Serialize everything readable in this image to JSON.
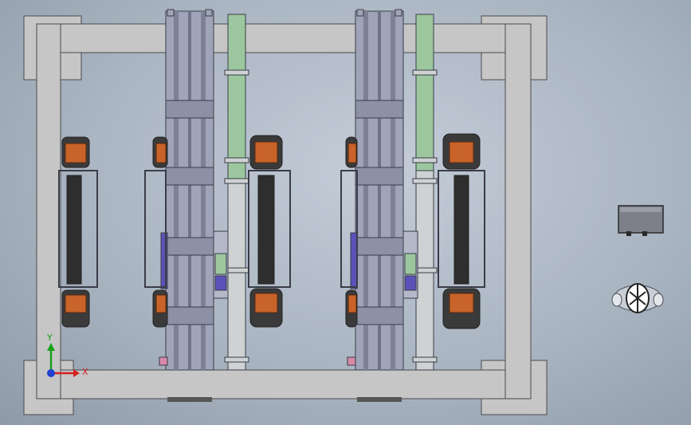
{
  "viewport": {
    "background_top": "#c4cdd8",
    "background_bottom": "#8f9aa8"
  },
  "colors": {
    "frame_fill": "#c6c6c6",
    "frame_stroke": "#4a4a4a",
    "rail_fill": "#9fa4b8",
    "rail_dark": "#6e7388",
    "guide_green": "#9cc79e",
    "guide_grey": "#cfd2d2",
    "motor_orange": "#c8632a",
    "motor_dark": "#3a3a3a",
    "purple_block": "#5a52b8",
    "pink_part": "#d88aa8",
    "axis_x": "#d62020",
    "axis_y": "#18a018",
    "axis_z": "#2040d0"
  },
  "triad": {
    "x_label": "X",
    "y_label": "Y"
  },
  "icons": {
    "controller_box": "electrical-cabinet-icon",
    "robot_part": "gripper-head-icon"
  }
}
